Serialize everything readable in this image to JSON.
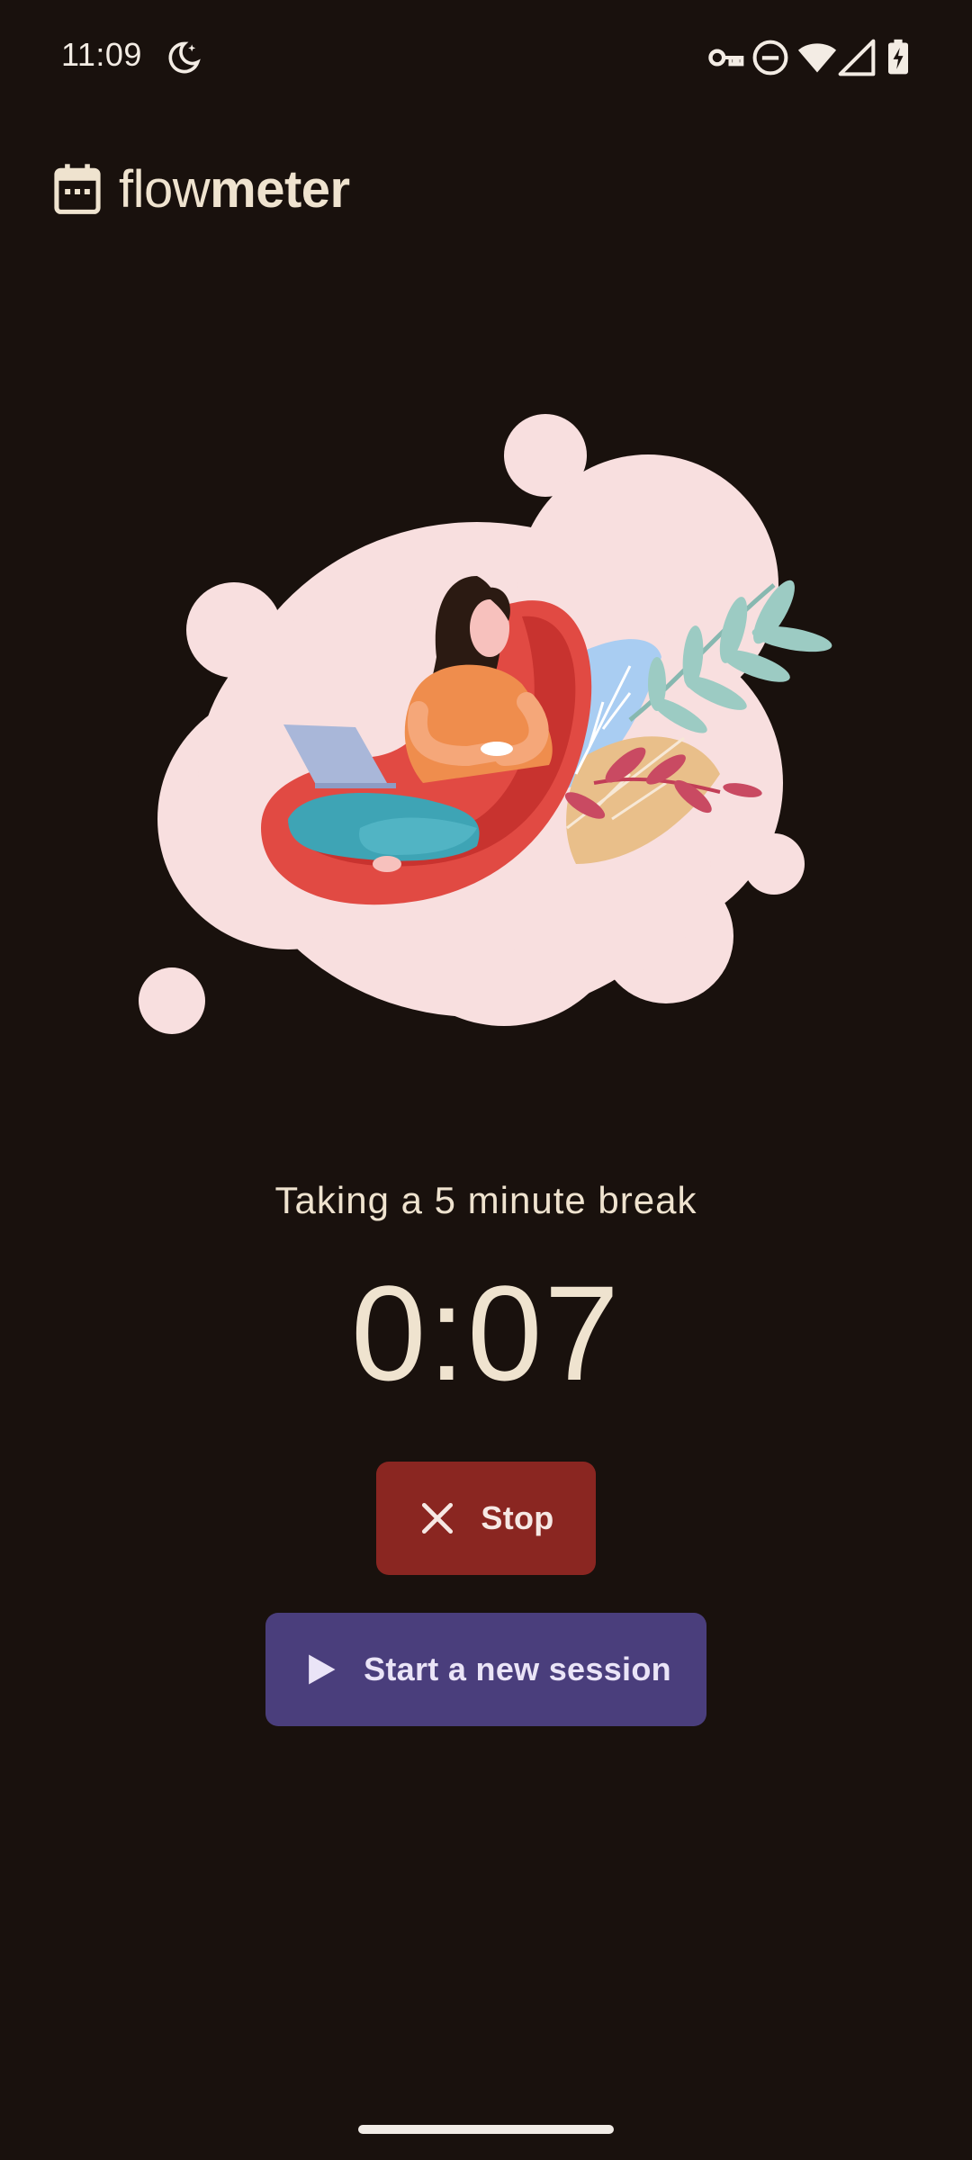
{
  "status_bar": {
    "time": "11:09",
    "icons": [
      "do-not-disturb-moon-icon",
      "vpn-key-icon",
      "do-not-disturb-icon",
      "wifi-icon",
      "cell-signal-icon",
      "battery-charging-icon"
    ]
  },
  "header": {
    "title_light": "flow",
    "title_bold": "meter",
    "logo_icon": "calendar-icon"
  },
  "main": {
    "status_text": "Taking a 5 minute break",
    "timer": "0:07",
    "illustration": "woman-relaxing-with-coffee-illustration"
  },
  "buttons": {
    "stop_label": "Stop",
    "stop_icon": "close-icon",
    "new_session_label": "Start a new session",
    "new_session_icon": "play-icon"
  },
  "colors": {
    "background": "#19110d",
    "text": "#efe3cf",
    "stop_button": "#8a2621",
    "new_session_button": "#4a3e7c",
    "illustration_cloud": "#f8dfdf"
  }
}
